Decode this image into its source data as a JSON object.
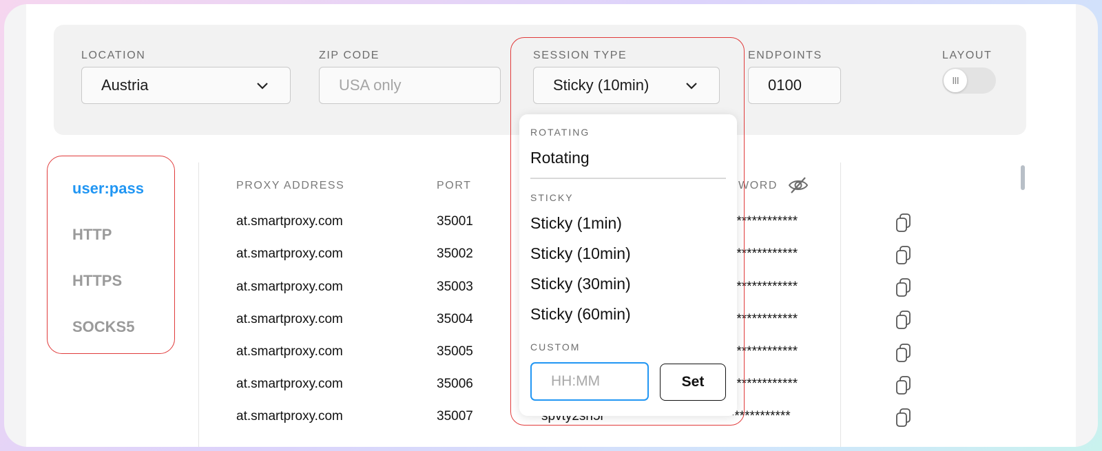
{
  "filters": {
    "location": {
      "label": "LOCATION",
      "value": "Austria"
    },
    "zip": {
      "label": "ZIP CODE",
      "placeholder": "USA only"
    },
    "session": {
      "label": "SESSION TYPE",
      "value": "Sticky (10min)"
    },
    "endpoints": {
      "label": "ENDPOINTS",
      "value": "0100"
    },
    "layout": {
      "label": "LAYOUT",
      "knob": "III"
    }
  },
  "protocols": [
    "user:pass",
    "HTTP",
    "HTTPS",
    "SOCKS5"
  ],
  "table": {
    "headers": {
      "address": "PROXY ADDRESS",
      "port": "PORT",
      "password": "WORD"
    },
    "rows": [
      {
        "address": "at.smartproxy.com",
        "port": "35001",
        "password": "*************"
      },
      {
        "address": "at.smartproxy.com",
        "port": "35002",
        "password": "*************"
      },
      {
        "address": "at.smartproxy.com",
        "port": "35003",
        "password": "*************"
      },
      {
        "address": "at.smartproxy.com",
        "port": "35004",
        "password": "*************"
      },
      {
        "address": "at.smartproxy.com",
        "port": "35005",
        "password": "*************"
      },
      {
        "address": "at.smartproxy.com",
        "port": "35006",
        "password": "*************"
      },
      {
        "address": "at.smartproxy.com",
        "port": "35007",
        "user": "spvty2sn5i",
        "password": "*****************"
      }
    ]
  },
  "dropdown": {
    "rotating_group": "ROTATING",
    "rotating_item": "Rotating",
    "sticky_group": "STICKY",
    "sticky_items": [
      "Sticky (1min)",
      "Sticky (10min)",
      "Sticky (30min)",
      "Sticky (60min)"
    ],
    "custom_group": "CUSTOM",
    "custom_placeholder": "HH:MM",
    "set_label": "Set"
  },
  "colors": {
    "accent": "#2196f3",
    "highlight": "#e03a3a"
  }
}
